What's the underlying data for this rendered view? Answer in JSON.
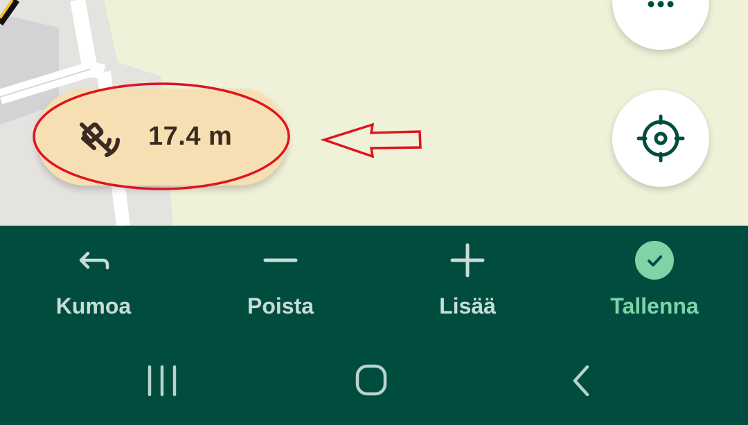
{
  "gps": {
    "accuracy": "17.4 m",
    "icon": "satellite-signal-icon"
  },
  "annotation": {
    "highlight_color": "#e0141e"
  },
  "fabs": [
    {
      "icon": "more-options-icon"
    },
    {
      "icon": "locate-me-icon"
    }
  ],
  "toolbar": {
    "undo": {
      "label": "Kumoa",
      "icon": "undo-arrow-icon"
    },
    "remove": {
      "label": "Poista",
      "icon": "minus-icon"
    },
    "add": {
      "label": "Lisää",
      "icon": "plus-icon"
    },
    "save": {
      "label": "Tallenna",
      "icon": "check-circle-icon",
      "color": "#7fd3a6"
    }
  },
  "system_nav": {
    "recents": "recents-icon",
    "home": "home-icon",
    "back": "back-icon"
  },
  "colors": {
    "toolbar_bg": "#004d40",
    "map_bg": "#eff1d9",
    "pill_bg": "#f6e0b3"
  }
}
